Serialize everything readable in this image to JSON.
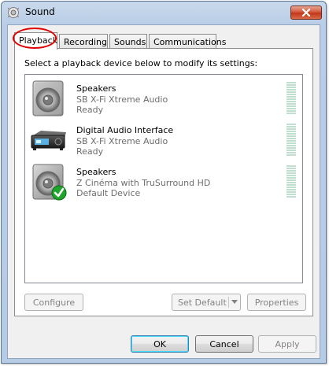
{
  "window": {
    "title": "Sound"
  },
  "tabs": [
    {
      "label": "Playback",
      "active": true
    },
    {
      "label": "Recording",
      "active": false
    },
    {
      "label": "Sounds",
      "active": false
    },
    {
      "label": "Communications",
      "active": false
    }
  ],
  "panel": {
    "instruction": "Select a playback device below to modify its settings:",
    "devices": [
      {
        "name": "Speakers",
        "description": "SB X-Fi Xtreme Audio",
        "status": "Ready",
        "icon": "speaker-icon",
        "default": false
      },
      {
        "name": "Digital Audio Interface",
        "description": "SB X-Fi Xtreme Audio",
        "status": "Ready",
        "icon": "digital-audio-interface-icon",
        "default": false
      },
      {
        "name": "Speakers",
        "description": "Z Cinéma with TruSurround HD",
        "status": "Default Device",
        "icon": "speaker-icon",
        "default": true
      }
    ],
    "buttons": {
      "configure": {
        "label": "Configure",
        "enabled": false
      },
      "set_default": {
        "label": "Set Default",
        "enabled": false
      },
      "properties": {
        "label": "Properties",
        "enabled": false
      }
    }
  },
  "footer": {
    "ok": {
      "label": "OK"
    },
    "cancel": {
      "label": "Cancel"
    },
    "apply": {
      "label": "Apply",
      "enabled": false
    }
  },
  "colors": {
    "highlight_ring": "#e00000",
    "default_check": "#1fa52c",
    "level_meter": "#bfe0cf"
  }
}
